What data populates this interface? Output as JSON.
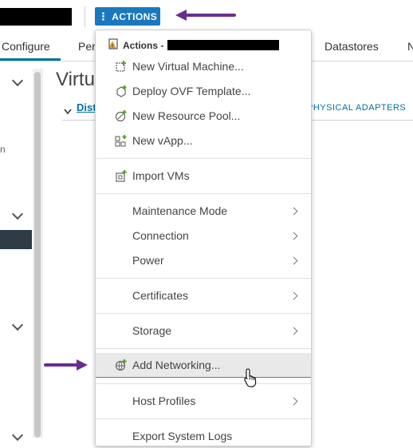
{
  "header": {
    "actions_label": "ACTIONS",
    "actions_icon": "kebab-vertical-icon"
  },
  "tabs": [
    {
      "label": "Configure"
    },
    {
      "label": "Per"
    },
    {
      "label": "Datastores"
    },
    {
      "label": "N"
    }
  ],
  "left_nav": {
    "fragment": "n"
  },
  "main": {
    "title": "Virtu",
    "subsection": "Dist",
    "physical_adapters": "PHYSICAL ADAPTERS"
  },
  "menu": {
    "header_label": "Actions -",
    "header_icon": "host-warning-icon",
    "items": [
      {
        "label": "New Virtual Machine...",
        "icon": "new-vm-icon"
      },
      {
        "label": "Deploy OVF Template...",
        "icon": "deploy-ovf-icon"
      },
      {
        "label": "New Resource Pool...",
        "icon": "resource-pool-icon"
      },
      {
        "label": "New vApp...",
        "icon": "vapp-icon"
      },
      {
        "label": "Import VMs",
        "icon": "import-vms-icon"
      },
      {
        "label": "Maintenance Mode",
        "submenu": true
      },
      {
        "label": "Connection",
        "submenu": true
      },
      {
        "label": "Power",
        "submenu": true
      },
      {
        "label": "Certificates",
        "submenu": true
      },
      {
        "label": "Storage",
        "submenu": true
      },
      {
        "label": "Add Networking...",
        "icon": "add-networking-icon",
        "hovered": true
      },
      {
        "label": "Host Profiles",
        "submenu": true
      },
      {
        "label": "Export System Logs"
      }
    ]
  },
  "colors": {
    "accent": "#1a78bf",
    "annotation_arrow": "#6b2c91",
    "link": "#0072a3"
  }
}
